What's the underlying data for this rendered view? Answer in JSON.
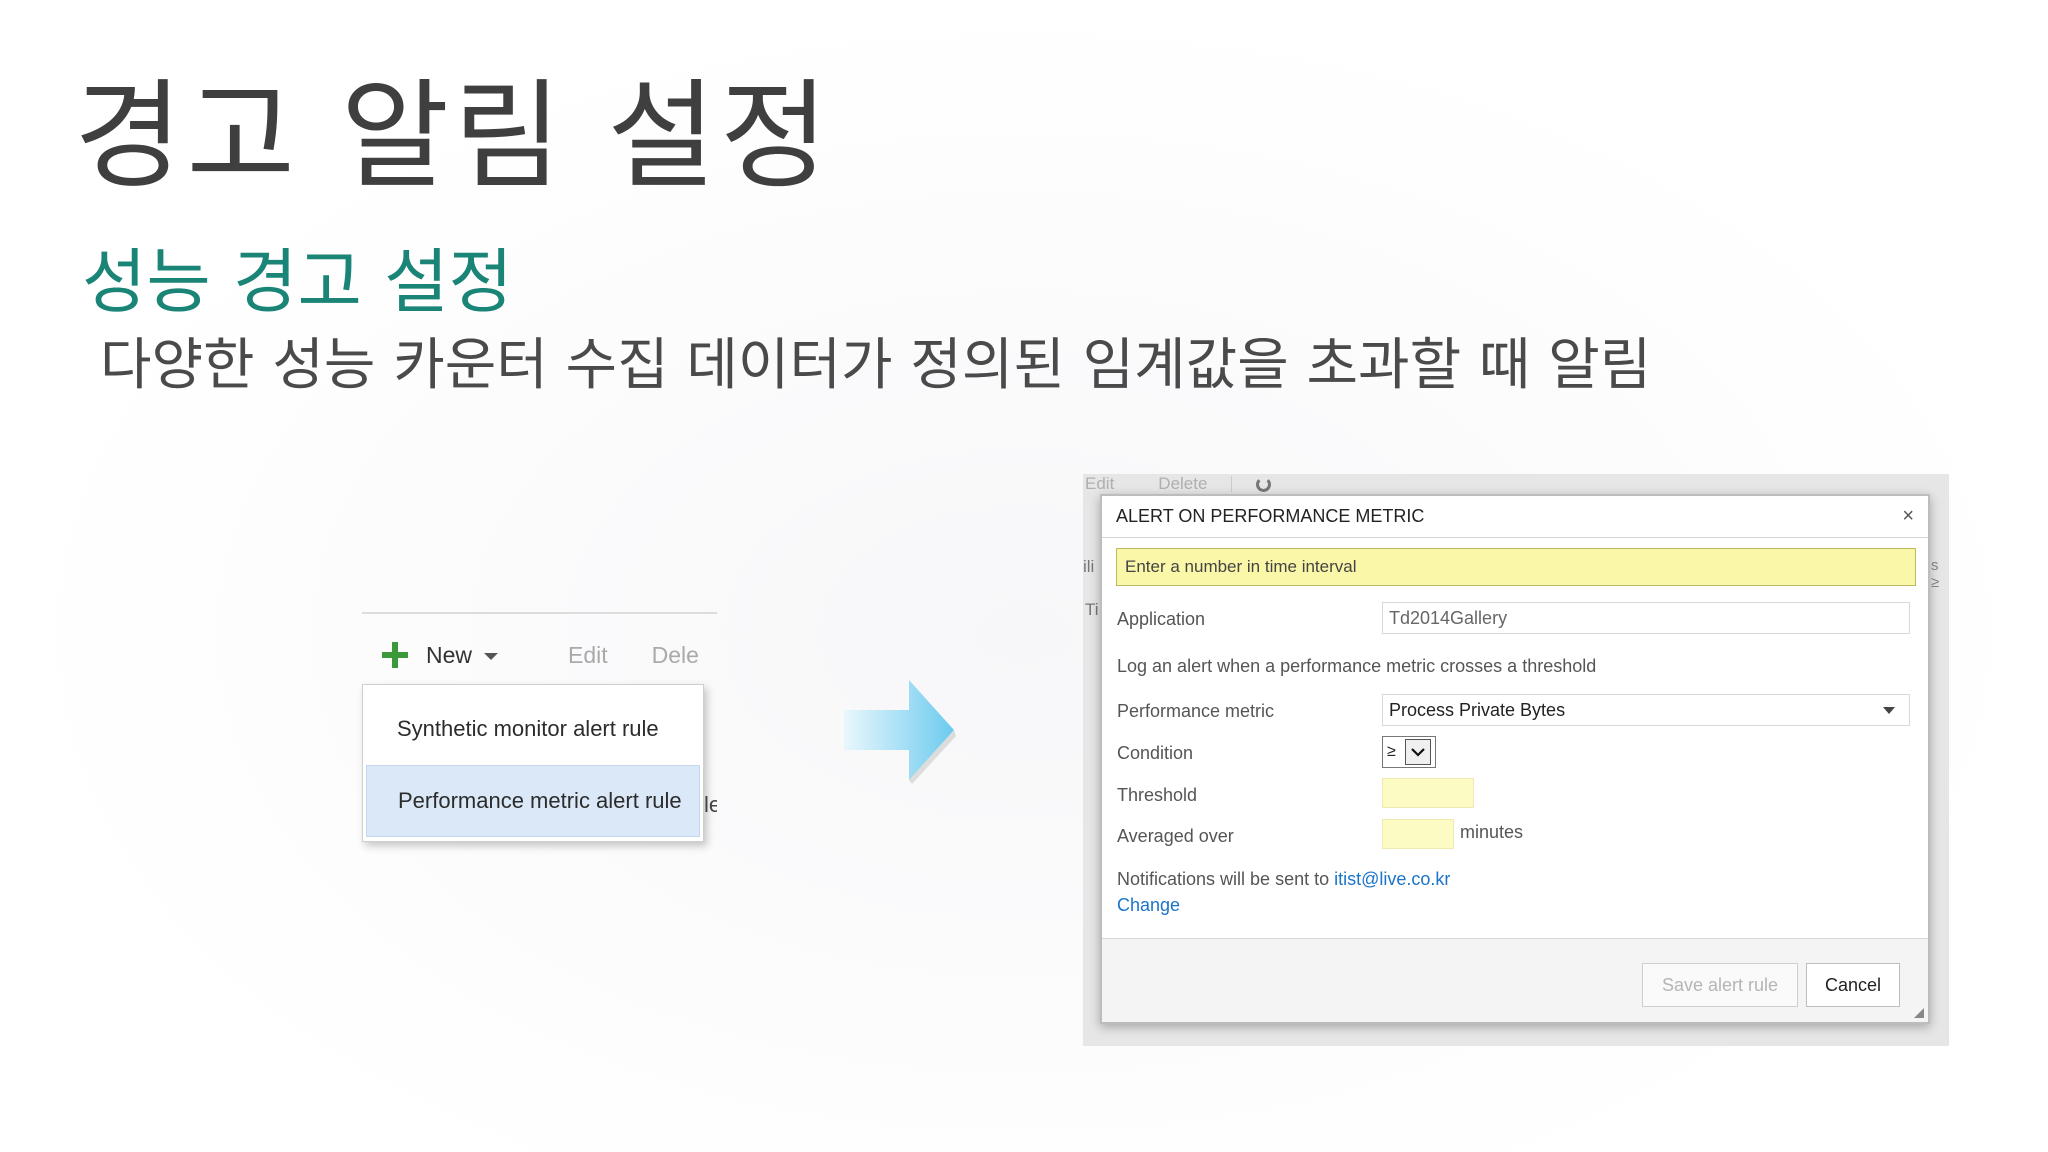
{
  "slide": {
    "title": "경고 알림 설정",
    "subtitle": "성능 경고 설정",
    "body": "다양한 성능 카운터 수집 데이터가 정의된 임계값을 초과할 때 알림"
  },
  "menu": {
    "new_label": "New",
    "edit_label": "Edit",
    "delete_label": "Delete",
    "items": [
      {
        "label": "Synthetic monitor alert rule"
      },
      {
        "label": "Performance metric alert rule"
      }
    ],
    "ghost_text": "le"
  },
  "background_toolbar": {
    "edit_label": "Edit",
    "delete_label": "Delete",
    "fragment_1": "ili",
    "fragment_2": "Ti",
    "fragment_3": "s ≥"
  },
  "dialog": {
    "title": "ALERT ON PERFORMANCE METRIC",
    "close_glyph": "×",
    "warning": "Enter a number in time interval",
    "application_label": "Application",
    "application_value": "Td2014Gallery",
    "description": "Log an alert when a performance metric crosses a threshold",
    "metric_label": "Performance metric",
    "metric_value": "Process Private Bytes",
    "condition_label": "Condition",
    "condition_value": "≥",
    "threshold_label": "Threshold",
    "threshold_value": "",
    "averaged_label": "Averaged over",
    "averaged_value": "",
    "averaged_unit": "minutes",
    "notify_text": "Notifications will be sent to",
    "notify_email": "itist@live.co.kr",
    "change_label": "Change",
    "save_label": "Save alert rule",
    "cancel_label": "Cancel"
  },
  "colors": {
    "subtitle": "#1a8476",
    "warning_bg": "#fbf7a8",
    "link": "#1a74c9",
    "plus_icon": "#3a9a3a",
    "arrow": "#7fd3f2"
  }
}
